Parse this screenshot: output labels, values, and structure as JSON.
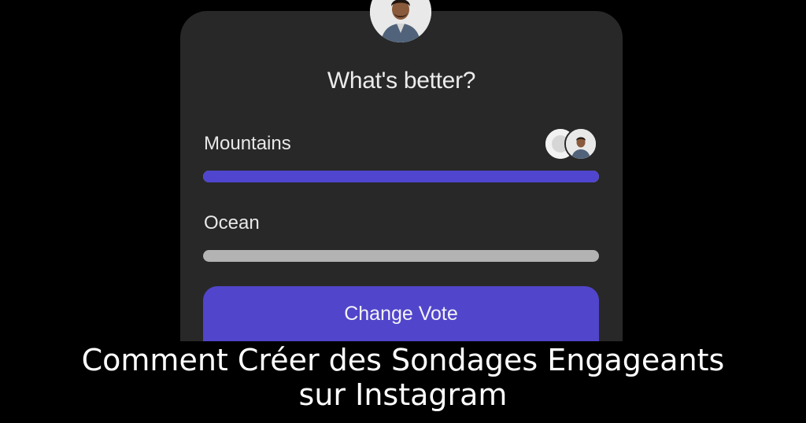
{
  "poll": {
    "question": "What's better?",
    "options": [
      {
        "label": "Mountains",
        "percent": 100,
        "color": "#4f45cf"
      },
      {
        "label": "Ocean",
        "percent": 0,
        "color": "#b3b3b3"
      }
    ],
    "button_label": "Change Vote",
    "button_color": "#5145cb"
  },
  "caption": {
    "line1": "Comment Créer des Sondages Engageants",
    "line2": "sur Instagram"
  },
  "icons": {
    "avatar": "profile-photo",
    "voters": [
      "voter-avatar-placeholder",
      "voter-profile-photo"
    ]
  }
}
